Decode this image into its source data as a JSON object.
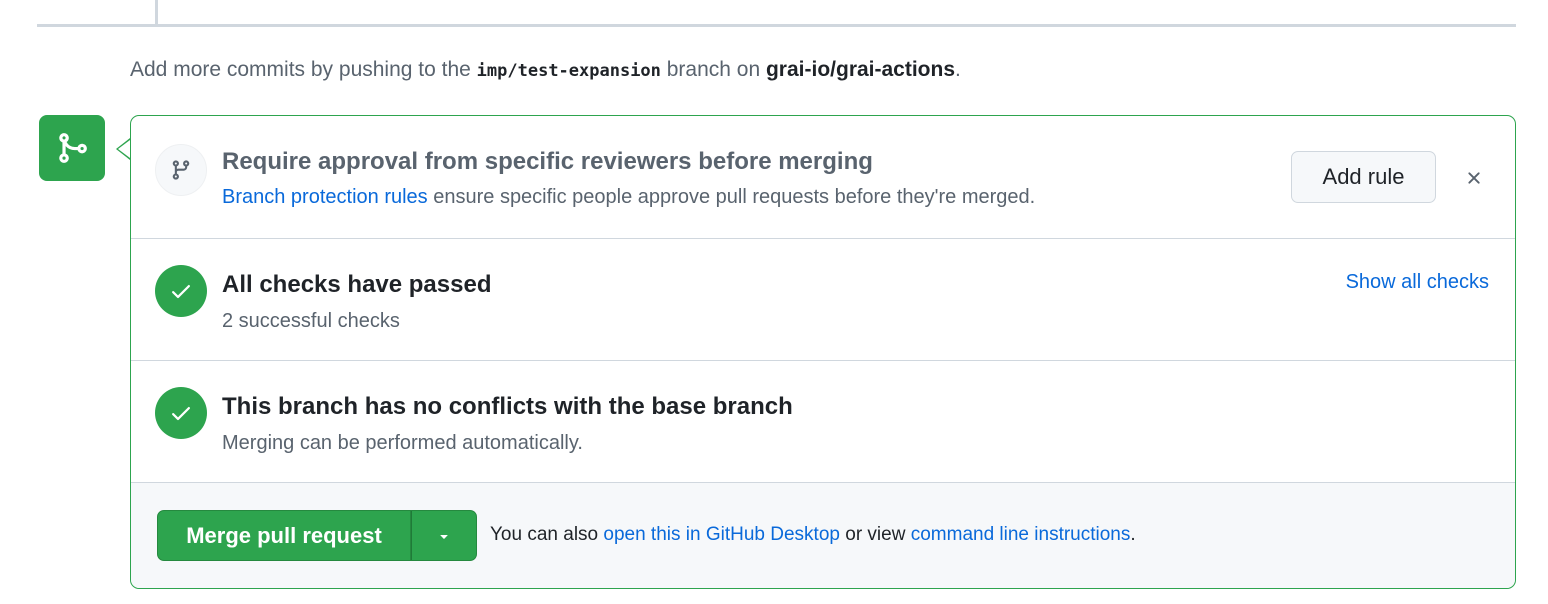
{
  "commit_hint": {
    "prefix": "Add more commits by pushing to the ",
    "branch": "imp/test-expansion",
    "middle": " branch on ",
    "repo": "grai-io/grai-actions",
    "suffix": "."
  },
  "merge_box": {
    "reviewers": {
      "title": "Require approval from specific reviewers before merging",
      "link": "Branch protection rules",
      "text": " ensure specific people approve pull requests before they're merged.",
      "add_rule_label": "Add rule"
    },
    "checks": {
      "title": "All checks have passed",
      "subtitle": "2 successful checks",
      "show_all_label": "Show all checks"
    },
    "conflicts": {
      "title": "This branch has no conflicts with the base branch",
      "subtitle": "Merging can be performed automatically."
    },
    "merge": {
      "button_label": "Merge pull request",
      "alt_prefix": "You can also ",
      "desktop_link": "open this in GitHub Desktop",
      "alt_middle": " or view ",
      "cli_link": "command line instructions",
      "alt_suffix": "."
    }
  },
  "icons": {
    "badge": "git-merge-icon",
    "reviewers": "git-branch-icon",
    "check": "check-icon",
    "dismiss": "close-icon",
    "dropdown": "triangle-down-icon"
  },
  "colors": {
    "success": "#2da44e",
    "link": "#0969da",
    "muted": "#59636e",
    "border": "#d0d7de"
  }
}
